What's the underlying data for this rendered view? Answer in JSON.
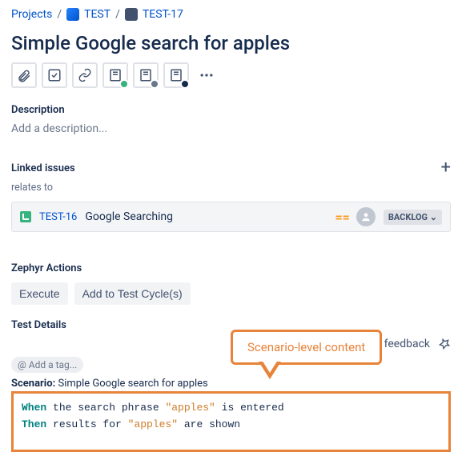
{
  "breadcrumb": {
    "root": "Projects",
    "project": "TEST",
    "issue": "TEST-17"
  },
  "title": "Simple Google search for apples",
  "description": {
    "heading": "Description",
    "placeholder": "Add a description..."
  },
  "linked": {
    "heading": "Linked issues",
    "relation": "relates to",
    "item": {
      "key": "TEST-16",
      "summary": "Google Searching",
      "priority_glyph": "=",
      "status": "BACKLOG ⌄"
    }
  },
  "zephyr": {
    "heading": "Zephyr Actions",
    "execute": "Execute",
    "add_cycle": "Add to Test Cycle(s)"
  },
  "details": {
    "heading": "Test Details",
    "feedback": "ve feedback",
    "add_tag": "@ Add a tag...",
    "scenario_label": "Scenario:",
    "scenario_name": "Simple Google search for apples",
    "code": {
      "when_kw": "When",
      "when_rest_a": " the search phrase ",
      "when_str": "\"apples\"",
      "when_rest_b": " is entered",
      "then_kw": "Then",
      "then_rest_a": " results for ",
      "then_str": "\"apples\"",
      "then_rest_b": " are shown"
    }
  },
  "callout": "Scenario-level content"
}
